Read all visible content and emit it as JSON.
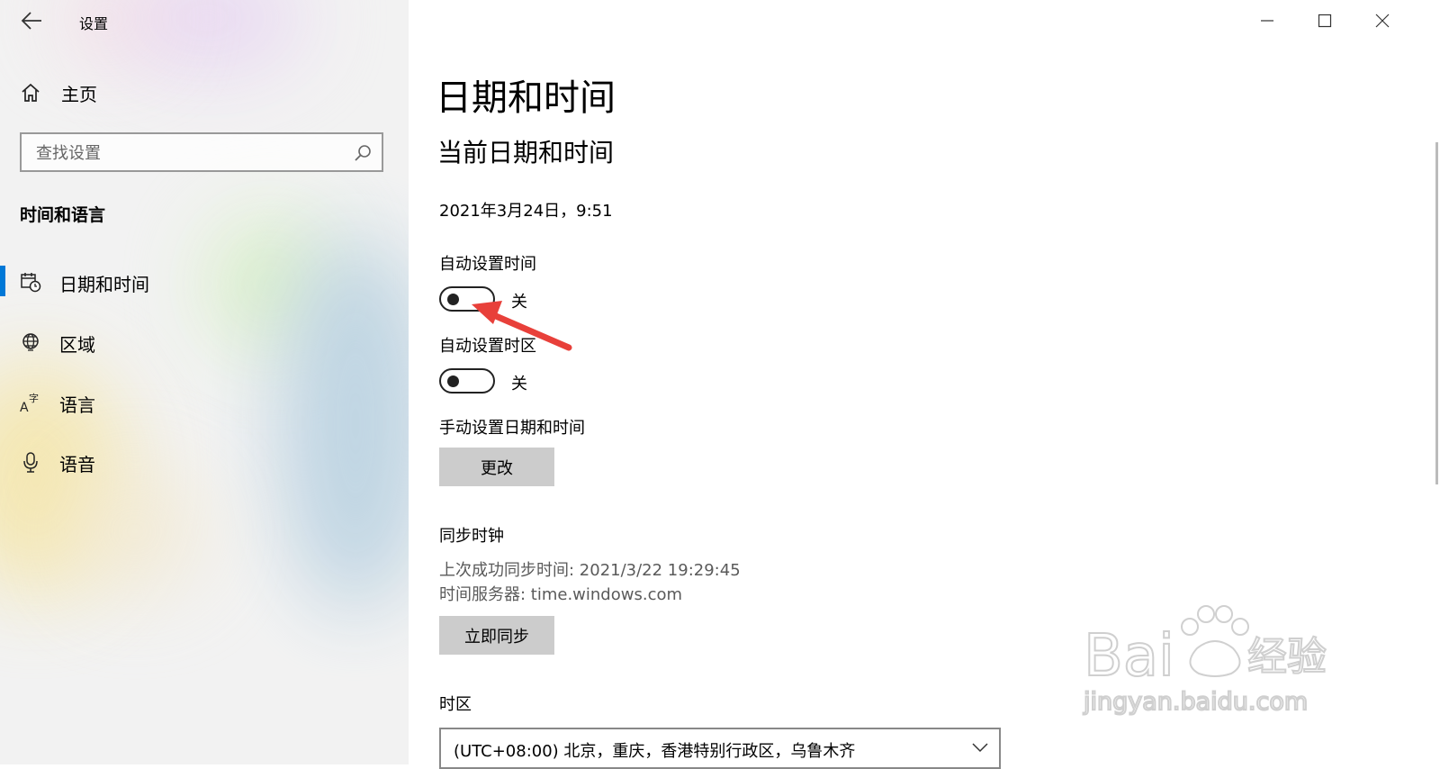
{
  "window": {
    "title": "设置",
    "controls": [
      "minimize-icon",
      "maximize-icon",
      "close-icon"
    ]
  },
  "sidebar": {
    "home_label": "主页",
    "search_placeholder": "查找设置",
    "section_title": "时间和语言",
    "items": [
      {
        "label": "日期和时间",
        "icon": "calendar-clock-icon",
        "selected": true
      },
      {
        "label": "区域",
        "icon": "globe-icon",
        "selected": false
      },
      {
        "label": "语言",
        "icon": "language-icon",
        "selected": false
      },
      {
        "label": "语音",
        "icon": "microphone-icon",
        "selected": false
      }
    ]
  },
  "main": {
    "page_title": "日期和时间",
    "subtitle": "当前日期和时间",
    "current_datetime": "2021年3月24日，9:51",
    "auto_time": {
      "label": "自动设置时间",
      "state": "关",
      "on": false
    },
    "auto_timezone": {
      "label": "自动设置时区",
      "state": "关",
      "on": false
    },
    "manual": {
      "label": "手动设置日期和时间",
      "button": "更改"
    },
    "sync": {
      "label": "同步时钟",
      "last_sync": "上次成功同步时间: 2021/3/22 19:29:45",
      "server": "时间服务器: time.windows.com",
      "button": "立即同步"
    },
    "timezone": {
      "label": "时区",
      "value": "(UTC+08:00) 北京，重庆，香港特别行政区，乌鲁木齐"
    }
  },
  "annotation": {
    "arrow_color": "#e8403a"
  },
  "watermark": {
    "brand": "Bai",
    "brand_cn": "经验",
    "url": "jingyan.baidu.com"
  },
  "colors": {
    "accent": "#0078d7",
    "button_bg": "#cccccc"
  }
}
